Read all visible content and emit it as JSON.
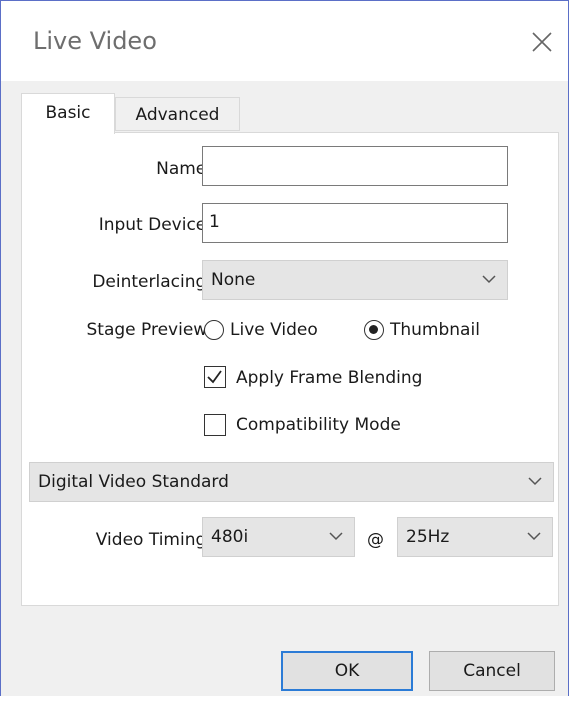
{
  "window": {
    "title": "Live Video"
  },
  "tabs": [
    {
      "label": "Basic",
      "selected": true
    },
    {
      "label": "Advanced",
      "selected": false
    }
  ],
  "form": {
    "name_label": "Name:",
    "name_value": "",
    "input_device_label": "Input Device:",
    "input_device_value": "1",
    "deinterlacing_label": "Deinterlacing:",
    "deinterlacing_value": "None",
    "stage_preview_label": "Stage Preview:",
    "radio_live_label": "Live Video",
    "radio_thumb_label": "Thumbnail",
    "stage_preview_selected": "Thumbnail",
    "frame_blending_label": "Apply Frame Blending",
    "frame_blending_checked": true,
    "compat_label": "Compatibility Mode",
    "compat_checked": false,
    "standard_value": "Digital Video Standard",
    "video_timing_label": "Video Timing:",
    "video_timing_value": "480i",
    "at_symbol": "@",
    "rate_value": "25Hz"
  },
  "buttons": {
    "ok": "OK",
    "cancel": "Cancel"
  },
  "colors": {
    "accent": "#2b7bd6",
    "window_border": "#5b6fc7"
  }
}
